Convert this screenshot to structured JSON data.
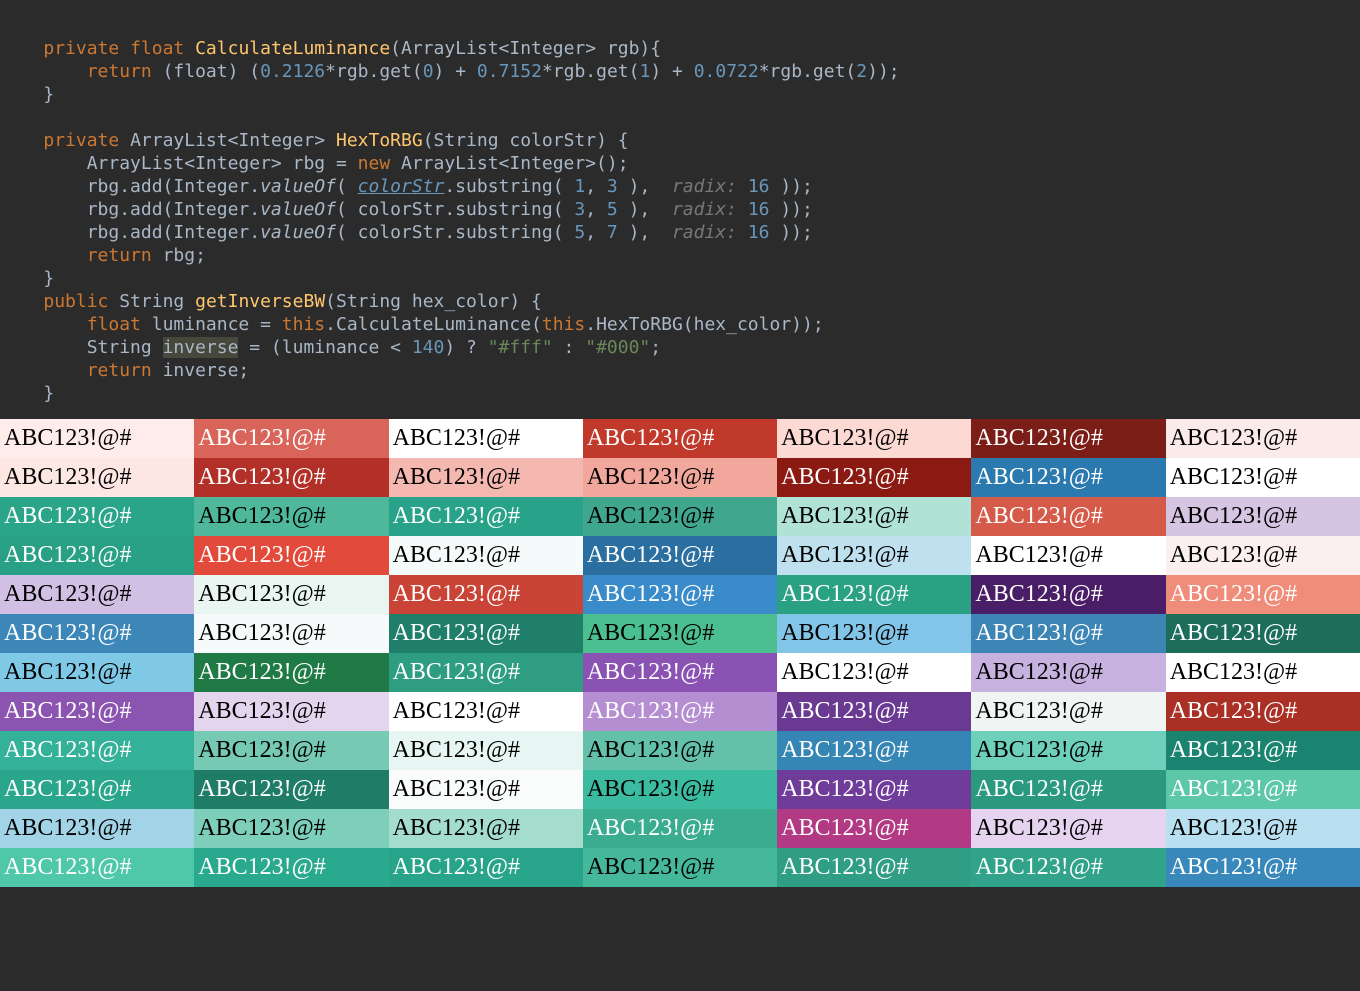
{
  "code": {
    "line1": {
      "kw1": "private",
      "kw2": "float",
      "fn": "CalculateLuminance",
      "sig": "(ArrayList<Integer> rgb){"
    },
    "line2": {
      "kw": "return",
      "cast": "(float)",
      "n1": "0.2126",
      "t1": "*rgb.get(",
      "a1": "0",
      "t2": ") + ",
      "n2": "0.7152",
      "t3": "*rgb.get(",
      "a2": "1",
      "t4": ") + ",
      "n3": "0.0722",
      "t5": "*rgb.get(",
      "a3": "2",
      "t6": "));"
    },
    "line3": "}",
    "line5": {
      "kw1": "private",
      "type": "ArrayList<Integer>",
      "fn": "HexToRBG",
      "sig": "(String colorStr) {"
    },
    "line6": {
      "t1": "ArrayList<Integer> rbg = ",
      "kw": "new",
      "t2": " ArrayList<Integer>();"
    },
    "line7": {
      "t1": "rbg.add(Integer.",
      "it": "valueOf",
      "t2": "( ",
      "under": "colorStr",
      "t3": ".substring( ",
      "n1": "1",
      "c": ", ",
      "n2": "3",
      "t4": " ),  ",
      "hint": "radix:",
      "sp": " ",
      "n3": "16",
      "t5": " )); "
    },
    "line8": {
      "t1": "rbg.add(Integer.",
      "it": "valueOf",
      "t2": "( colorStr.substring( ",
      "n1": "3",
      "c": ", ",
      "n2": "5",
      "t4": " ),  ",
      "hint": "radix:",
      "sp": " ",
      "n3": "16",
      "t5": " )); "
    },
    "line9": {
      "t1": "rbg.add(Integer.",
      "it": "valueOf",
      "t2": "( colorStr.substring( ",
      "n1": "5",
      "c": ", ",
      "n2": "7",
      "t4": " ),  ",
      "hint": "radix:",
      "sp": " ",
      "n3": "16",
      "t5": " )); "
    },
    "line10": {
      "kw": "return",
      "v": " rbg;"
    },
    "line11": "}",
    "line12": {
      "kw1": "public",
      "type": "String",
      "fn": "getInverseBW",
      "sig": "(String hex_color) {"
    },
    "line13": {
      "kw": "float",
      "t1": " luminance = ",
      "kw2": "this",
      "t2": ".CalculateLuminance(",
      "kw3": "this",
      "t3": ".HexToRBG(hex_color));"
    },
    "line14": {
      "t1": "String ",
      "hl": "inverse",
      "t2": " = (luminance < ",
      "n": "140",
      "t3": ") ? ",
      "s1": "\"#fff\"",
      "t4": " : ",
      "s2": "\"#000\"",
      "t5": ";"
    },
    "line15": {
      "kw": "return",
      "v": " inverse;"
    },
    "line16": "}"
  },
  "sample_text": "ABC123!@#",
  "grid": [
    [
      {
        "bg": "#fdecea",
        "fg": "#000"
      },
      {
        "bg": "#d96459",
        "fg": "#fff"
      },
      {
        "bg": "#ffffff",
        "fg": "#000"
      },
      {
        "bg": "#c0392b",
        "fg": "#fff"
      },
      {
        "bg": "#fcd9d3",
        "fg": "#000"
      },
      {
        "bg": "#7b1e17",
        "fg": "#fff"
      },
      {
        "bg": "#fbeaea",
        "fg": "#000"
      }
    ],
    [
      {
        "bg": "#fde7e3",
        "fg": "#000"
      },
      {
        "bg": "#b23028",
        "fg": "#fff"
      },
      {
        "bg": "#f5b8b0",
        "fg": "#000"
      },
      {
        "bg": "#f1a79c",
        "fg": "#000"
      },
      {
        "bg": "#8b1a13",
        "fg": "#fff"
      },
      {
        "bg": "#2a7ab0",
        "fg": "#fff"
      },
      {
        "bg": "#ffffff",
        "fg": "#000"
      }
    ],
    [
      {
        "bg": "#2ba58a",
        "fg": "#fff"
      },
      {
        "bg": "#4fb89b",
        "fg": "#000"
      },
      {
        "bg": "#28a389",
        "fg": "#fff"
      },
      {
        "bg": "#41a68e",
        "fg": "#000"
      },
      {
        "bg": "#b0e3d6",
        "fg": "#000"
      },
      {
        "bg": "#d65a49",
        "fg": "#fff"
      },
      {
        "bg": "#d6c4e3",
        "fg": "#000"
      }
    ],
    [
      {
        "bg": "#27a085",
        "fg": "#fff"
      },
      {
        "bg": "#e24a3b",
        "fg": "#fff"
      },
      {
        "bg": "#f5fbfa",
        "fg": "#000"
      },
      {
        "bg": "#2a6fa0",
        "fg": "#fff"
      },
      {
        "bg": "#bfe0ef",
        "fg": "#000"
      },
      {
        "bg": "#ffffff",
        "fg": "#000"
      },
      {
        "bg": "#fcefef",
        "fg": "#000"
      }
    ],
    [
      {
        "bg": "#d1c0e3",
        "fg": "#000"
      },
      {
        "bg": "#e8f5f1",
        "fg": "#000"
      },
      {
        "bg": "#c94436",
        "fg": "#fff"
      },
      {
        "bg": "#3a8bc9",
        "fg": "#fff"
      },
      {
        "bg": "#2ba184",
        "fg": "#fff"
      },
      {
        "bg": "#4a1e66",
        "fg": "#fff"
      },
      {
        "bg": "#f08d7a",
        "fg": "#fff"
      }
    ],
    [
      {
        "bg": "#3c87b8",
        "fg": "#fff"
      },
      {
        "bg": "#f7fafa",
        "fg": "#000"
      },
      {
        "bg": "#1f7f6a",
        "fg": "#fff"
      },
      {
        "bg": "#4bbf8f",
        "fg": "#000"
      },
      {
        "bg": "#83c5e8",
        "fg": "#000"
      },
      {
        "bg": "#3c85b4",
        "fg": "#fff"
      },
      {
        "bg": "#1c6e5b",
        "fg": "#fff"
      }
    ],
    [
      {
        "bg": "#7fc8e6",
        "fg": "#000"
      },
      {
        "bg": "#1f7a45",
        "fg": "#fff"
      },
      {
        "bg": "#2f9d82",
        "fg": "#fff"
      },
      {
        "bg": "#8a52b3",
        "fg": "#fff"
      },
      {
        "bg": "#ffffff",
        "fg": "#000"
      },
      {
        "bg": "#c7b1df",
        "fg": "#000"
      },
      {
        "bg": "#ffffff",
        "fg": "#000"
      }
    ],
    [
      {
        "bg": "#8b54b0",
        "fg": "#fff"
      },
      {
        "bg": "#e3d5ee",
        "fg": "#000"
      },
      {
        "bg": "#ffffff",
        "fg": "#000"
      },
      {
        "bg": "#b48ed1",
        "fg": "#fff"
      },
      {
        "bg": "#6a3a93",
        "fg": "#fff"
      },
      {
        "bg": "#f0f5f4",
        "fg": "#000"
      },
      {
        "bg": "#aa2f25",
        "fg": "#fff"
      }
    ],
    [
      {
        "bg": "#33b199",
        "fg": "#fff"
      },
      {
        "bg": "#76c9b2",
        "fg": "#000"
      },
      {
        "bg": "#e7f6f2",
        "fg": "#000"
      },
      {
        "bg": "#62c1a8",
        "fg": "#000"
      },
      {
        "bg": "#3585b5",
        "fg": "#fff"
      },
      {
        "bg": "#6ed0bb",
        "fg": "#000"
      },
      {
        "bg": "#1a8470",
        "fg": "#fff"
      }
    ],
    [
      {
        "bg": "#2aa68c",
        "fg": "#fff"
      },
      {
        "bg": "#1e7c67",
        "fg": "#fff"
      },
      {
        "bg": "#f9fcfb",
        "fg": "#000"
      },
      {
        "bg": "#3bbba0",
        "fg": "#000"
      },
      {
        "bg": "#6f3c99",
        "fg": "#fff"
      },
      {
        "bg": "#2b9880",
        "fg": "#fff"
      },
      {
        "bg": "#5dc8a8",
        "fg": "#fff"
      }
    ],
    [
      {
        "bg": "#a3d3e7",
        "fg": "#000"
      },
      {
        "bg": "#7dcfba",
        "fg": "#000"
      },
      {
        "bg": "#a4dccd",
        "fg": "#000"
      },
      {
        "bg": "#3aac90",
        "fg": "#fff"
      },
      {
        "bg": "#b23a84",
        "fg": "#fff"
      },
      {
        "bg": "#e6d3ef",
        "fg": "#000"
      },
      {
        "bg": "#b9e0f0",
        "fg": "#000"
      }
    ],
    [
      {
        "bg": "#4fc7a9",
        "fg": "#fff"
      },
      {
        "bg": "#29a98d",
        "fg": "#fff"
      },
      {
        "bg": "#28a48a",
        "fg": "#fff"
      },
      {
        "bg": "#45b89c",
        "fg": "#000"
      },
      {
        "bg": "#2f9e85",
        "fg": "#fff"
      },
      {
        "bg": "#31a38a",
        "fg": "#fff"
      },
      {
        "bg": "#3888bc",
        "fg": "#fff"
      }
    ]
  ]
}
